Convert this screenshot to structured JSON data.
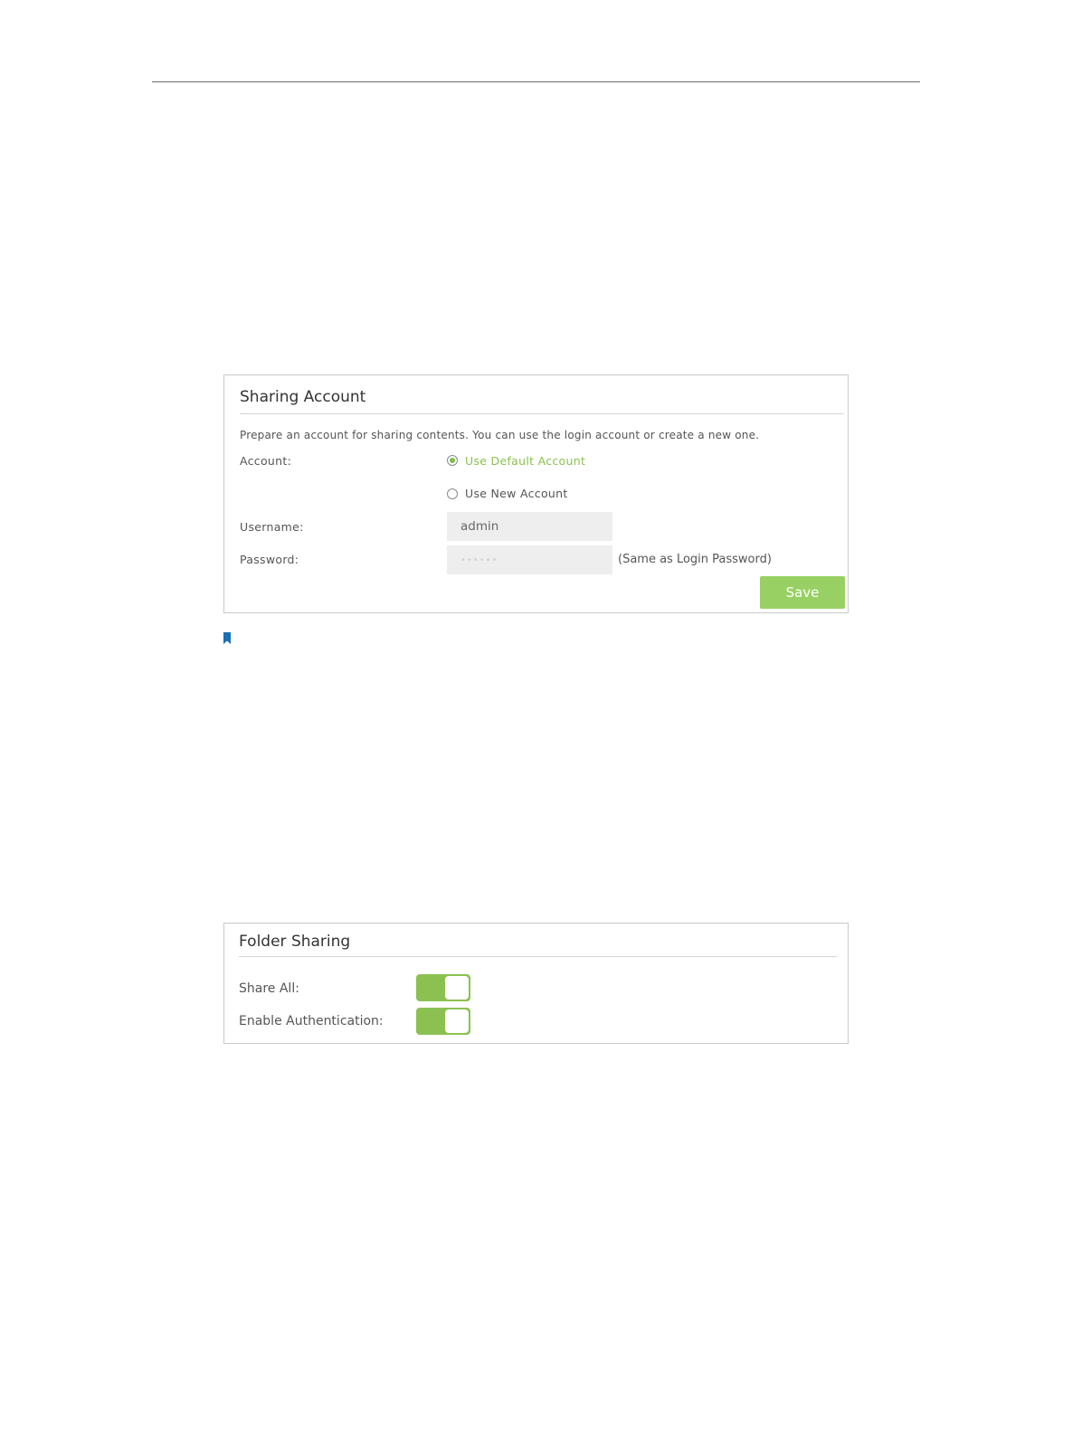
{
  "sharing_account": {
    "title": "Sharing Account",
    "description": "Prepare an account for sharing contents. You can use the login account or create a new one.",
    "account_label": "Account:",
    "options": [
      {
        "label": "Use Default Account",
        "selected": true
      },
      {
        "label": "Use New Account",
        "selected": false
      }
    ],
    "username_label": "Username:",
    "username_value": "admin",
    "password_label": "Password:",
    "password_value": "••••••",
    "password_hint": "(Same as Login Password)",
    "save_label": "Save"
  },
  "folder_sharing": {
    "title": "Folder Sharing",
    "share_all_label": "Share All:",
    "share_all_on": true,
    "auth_label": "Enable Authentication:",
    "auth_on": true
  },
  "colors": {
    "accent_green": "#8cc152",
    "button_green": "#98d063",
    "bookmark_blue": "#1a6fb5"
  },
  "icons": {
    "note": "bookmark-icon"
  }
}
